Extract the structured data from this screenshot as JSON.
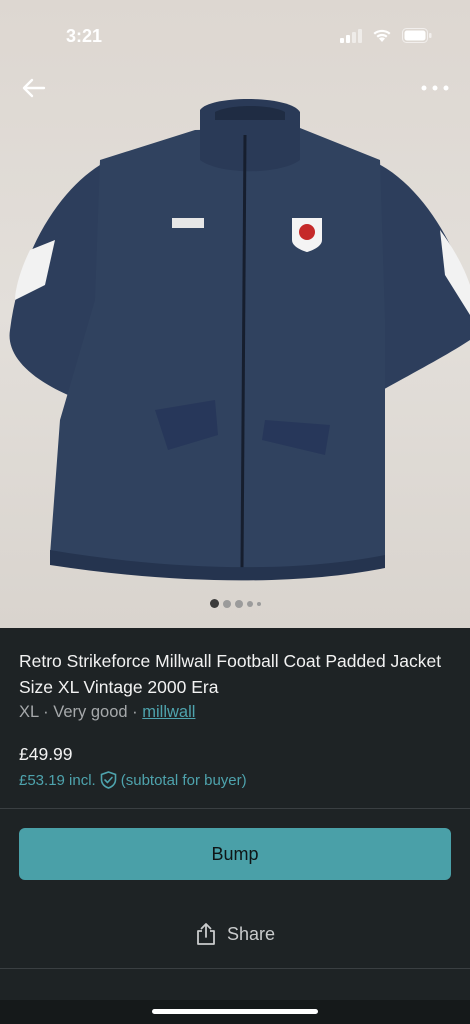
{
  "status_bar": {
    "time": "3:21"
  },
  "listing": {
    "title": "Retro Strikeforce Millwall Football Coat Padded Jacket Size XL Vintage 2000 Era",
    "size": "XL",
    "condition": "Very good",
    "separator": "·",
    "brand": "millwall",
    "price": "£49.99",
    "price_incl": "£53.19 incl.",
    "subtotal_note": "(subtotal for buyer)"
  },
  "pager": {
    "total": 5,
    "current": 1
  },
  "actions": {
    "bump_label": "Bump",
    "share_label": "Share"
  },
  "colors": {
    "accent": "#4aa0a8",
    "background": "#1e2325",
    "jacket": "#2e3f5e"
  }
}
